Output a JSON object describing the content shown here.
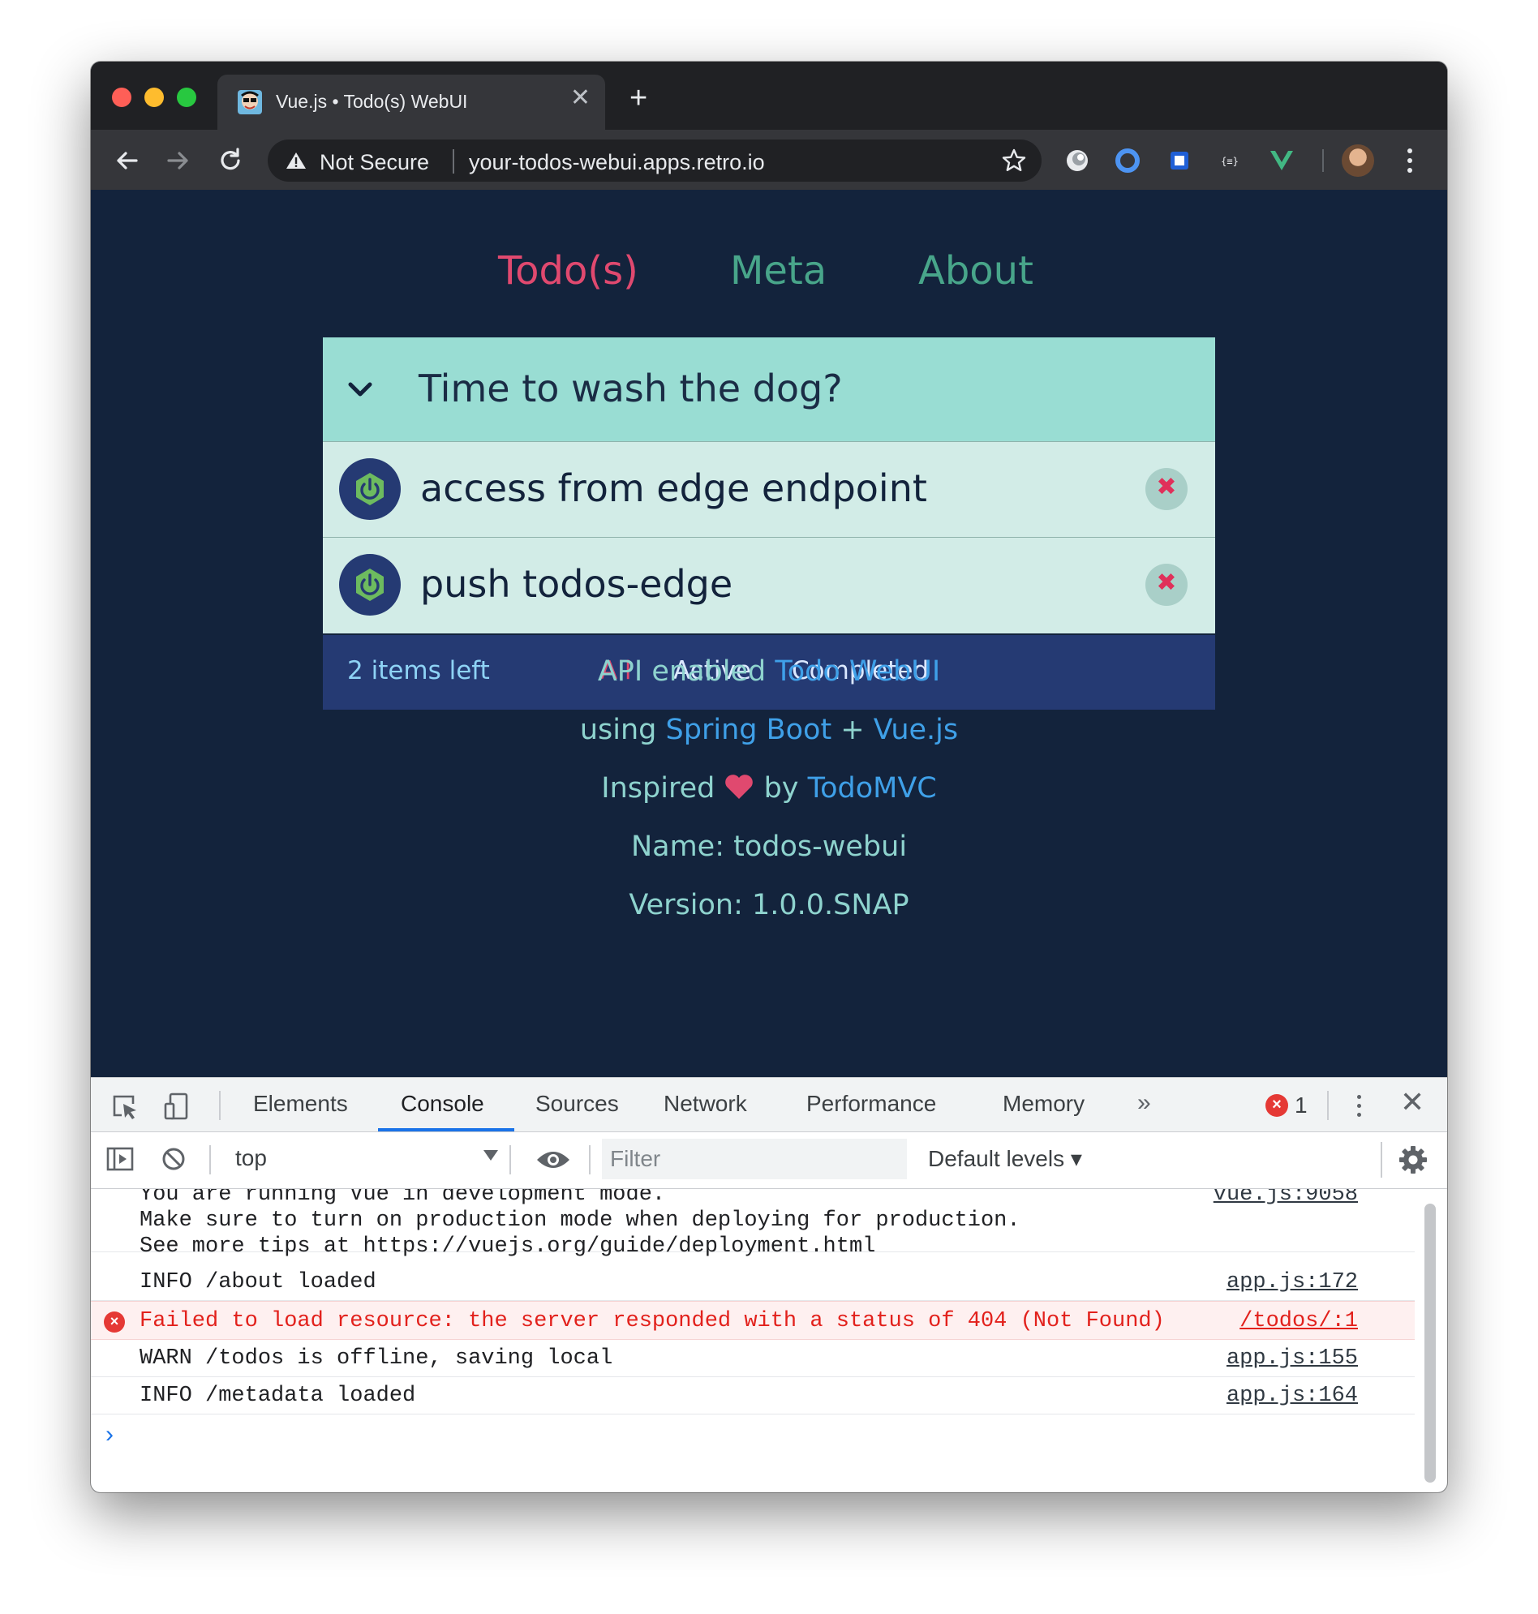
{
  "browser": {
    "tab_title": "Vue.js • Todo(s) WebUI",
    "tab_close": "✕",
    "new_tab": "+",
    "security_label": "Not Secure",
    "url": "your-todos-webui.apps.retro.io"
  },
  "app": {
    "nav": [
      "Todo(s)",
      "Meta",
      "About"
    ],
    "todo_title": "Time to wash the dog?",
    "todos": [
      {
        "text": "access from edge endpoint"
      },
      {
        "text": "push todos-edge"
      }
    ],
    "delete_glyph": "✖",
    "items_left": "2 items left",
    "filters": [
      "All",
      "Active",
      "Completed"
    ],
    "info": {
      "line1_text": "API enabled ",
      "line1_link": "Todo WebUI",
      "line2_text": "using ",
      "line2_link1": "Spring Boot",
      "line2_plus": " + ",
      "line2_link2": "Vue.js",
      "line3_text1": "Inspired ",
      "line3_text2": " by ",
      "line3_link": "TodoMVC",
      "name": "Name: todos-webui",
      "version": "Version: 1.0.0.SNAP"
    },
    "colors": {
      "background": "#13233c",
      "header": "#99ddd3",
      "item": "#d2ece7",
      "footer": "#253a73",
      "accent_pink": "#e0496f",
      "link_blue": "#3fa0e8"
    }
  },
  "devtools": {
    "tabs": [
      "Elements",
      "Console",
      "Sources",
      "Network",
      "Performance",
      "Memory"
    ],
    "more": "»",
    "error_count": "1",
    "close": "✕",
    "context": "top",
    "filter_placeholder": "Filter",
    "levels": "Default levels ▾",
    "logs": [
      {
        "lines": [
          "You are running Vue in development mode.",
          "Make sure to turn on production mode when deploying for production.",
          "See more tips at "
        ],
        "link": "https://vuejs.org/guide/deployment.html",
        "source": "vue.js:9058"
      },
      {
        "text": "INFO /about loaded",
        "source": "app.js:172"
      },
      {
        "text": "Failed to load resource: the server responded with a status of 404 (Not Found)",
        "source": "/todos/:1",
        "level": "error"
      },
      {
        "text": "WARN /todos is offline, saving local",
        "source": "app.js:155"
      },
      {
        "text": "INFO /metadata loaded",
        "source": "app.js:164"
      }
    ],
    "prompt": "›"
  }
}
